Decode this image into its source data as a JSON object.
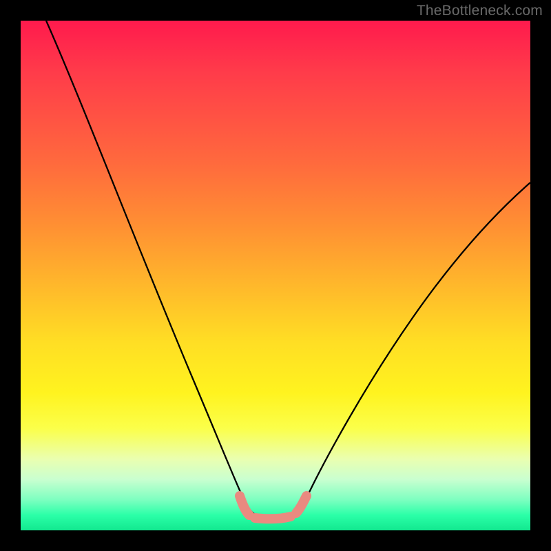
{
  "watermark": "TheBottleneck.com",
  "chart_data": {
    "type": "line",
    "title": "",
    "xlabel": "",
    "ylabel": "",
    "xlim": [
      0,
      100
    ],
    "ylim": [
      0,
      100
    ],
    "series": [
      {
        "name": "curve",
        "x": [
          5,
          10,
          15,
          20,
          25,
          30,
          35,
          38,
          40,
          42,
          44,
          45.5,
          47.5,
          50,
          52,
          54,
          55.5,
          58,
          62,
          68,
          75,
          82,
          90,
          100
        ],
        "values": [
          100,
          88,
          75,
          63,
          51,
          40,
          28,
          20,
          14,
          9,
          5,
          3.5,
          3,
          2.8,
          2.8,
          3.2,
          5,
          10,
          18,
          28,
          38,
          46,
          54,
          63
        ]
      }
    ],
    "annotations": [
      {
        "name": "valley-marker",
        "x_range": [
          44,
          55
        ],
        "y": 3.2
      }
    ]
  },
  "colors": {
    "curve_stroke": "#000000",
    "valley_marker": "#e98a80"
  }
}
